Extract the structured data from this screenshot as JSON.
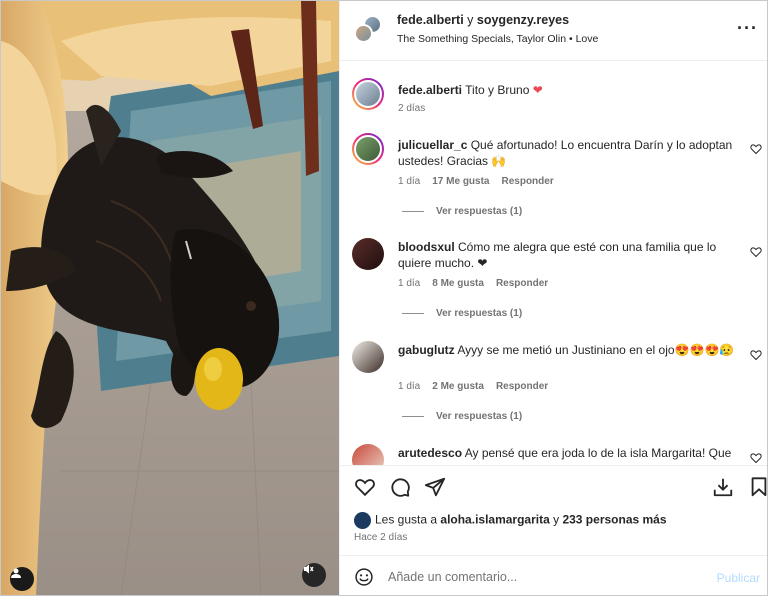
{
  "header": {
    "user1": "fede.alberti",
    "conj": " y ",
    "user2": "soygenzy.reyes",
    "song": "The Something Specials, Taylor Olin",
    "sep": " • ",
    "song_title": "Love",
    "more_icon": "more-horizontal-icon"
  },
  "caption": {
    "user": "fede.alberti",
    "text": "Tito y Bruno",
    "emoji": "❤",
    "time": "2 días"
  },
  "comments": [
    {
      "user": "julicuellar_c",
      "text": "Qué afortunado! Lo encuentra Darín y lo adoptan ustedes! Gracias 🙌",
      "time": "1 día",
      "likes": "17 Me gusta",
      "reply": "Responder",
      "replies": "Ver respuestas (1)"
    },
    {
      "user": "bloodsxul",
      "text": "Cómo me alegra que esté con una familia que lo quiere mucho. ❤",
      "time": "1 día",
      "likes": "8 Me gusta",
      "reply": "Responder",
      "replies": "Ver respuestas (1)"
    },
    {
      "user": "gabuglutz",
      "text": "Ayyy se me metió un Justiniano en el ojo😍😍😍😥",
      "time": "1 día",
      "likes": "2 Me gusta",
      "reply": "Responder",
      "replies": "Ver respuestas (1)"
    },
    {
      "user": "arutedesco",
      "text": "Ay pensé que era joda lo de la isla Margarita! Que"
    }
  ],
  "likes": {
    "prefix": "Les gusta a ",
    "user": "aloha.islamargarita",
    "suffix": " y ",
    "others": "233 personas más"
  },
  "time_ago": "Hace 2 días",
  "composer": {
    "placeholder": "Añade un comentario...",
    "publish": "Publicar"
  },
  "colors": {
    "accent_disabled": "#b3dbff",
    "heart": "#ed4956",
    "muted": "#737373"
  },
  "icons": [
    "like-heart-icon",
    "comment-icon",
    "share-icon",
    "download-icon",
    "save-bookmark-icon",
    "emoji-icon",
    "mute-icon",
    "user-tag-icon"
  ]
}
